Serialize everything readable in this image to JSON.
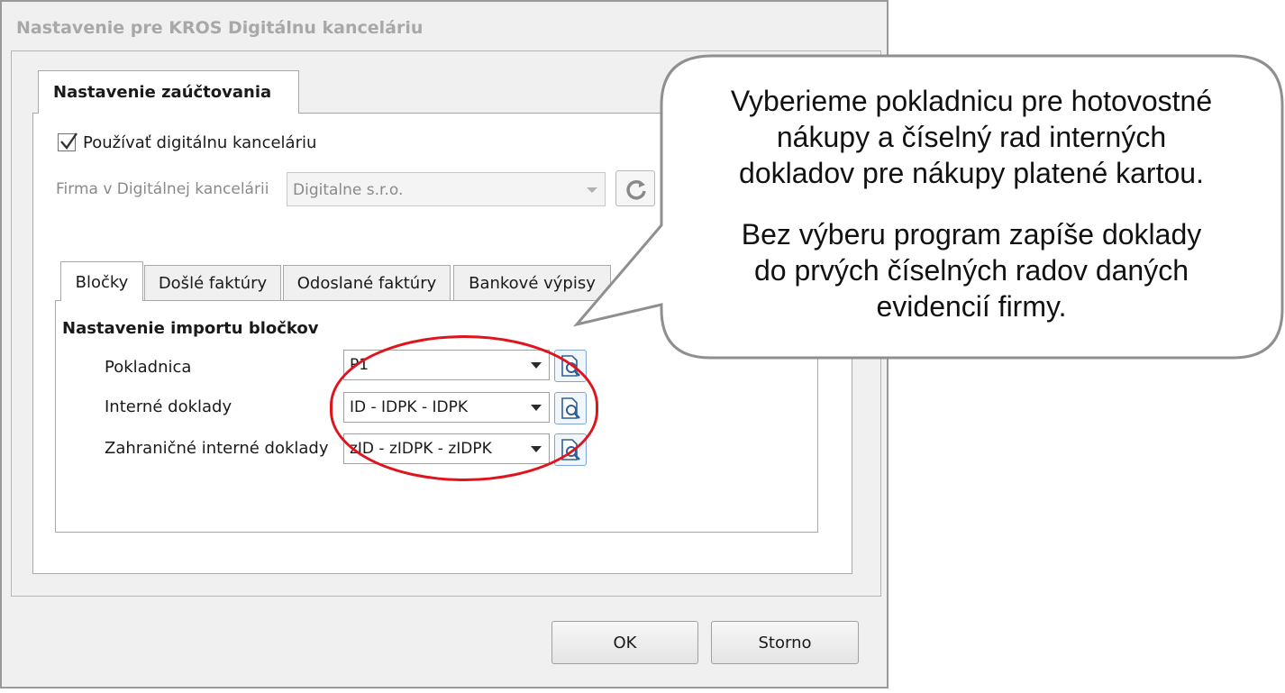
{
  "dialog": {
    "title": "Nastavenie pre KROS Digitálnu kanceláriu",
    "main_tab": "Nastavenie zaúčtovania",
    "use_checkbox": {
      "label": "Používať digitálnu kanceláriu",
      "checked": true
    },
    "firma": {
      "label": "Firma v Digitálnej kancelárii",
      "value": "Digitalne s.r.o."
    },
    "sub_tabs": [
      {
        "label": "Bločky",
        "active": true
      },
      {
        "label": "Došlé faktúry",
        "active": false
      },
      {
        "label": "Odoslané faktúry",
        "active": false
      },
      {
        "label": "Bankové výpisy",
        "active": false
      }
    ],
    "section_title": "Nastavenie importu bločkov",
    "fields": [
      {
        "label": "Pokladnica",
        "value": "P1"
      },
      {
        "label": "Interné doklady",
        "value": "ID - IDPK - IDPK"
      },
      {
        "label": "Zahraničné interné doklady",
        "value": "zID - zIDPK - zIDPK"
      }
    ],
    "buttons": {
      "ok": "OK",
      "cancel": "Storno"
    }
  },
  "callout": {
    "paragraph1": [
      "Vyberieme pokladnicu pre hotovostné",
      "nákupy a číselný rad interných",
      "dokladov pre nákupy platené kartou."
    ],
    "paragraph2": [
      "Bez výberu program zapíše doklady",
      "do prvých číselných radov daných",
      "evidencií firmy."
    ]
  },
  "colors": {
    "highlight": "#e0141c",
    "disabled_text": "#a8a8a8"
  }
}
